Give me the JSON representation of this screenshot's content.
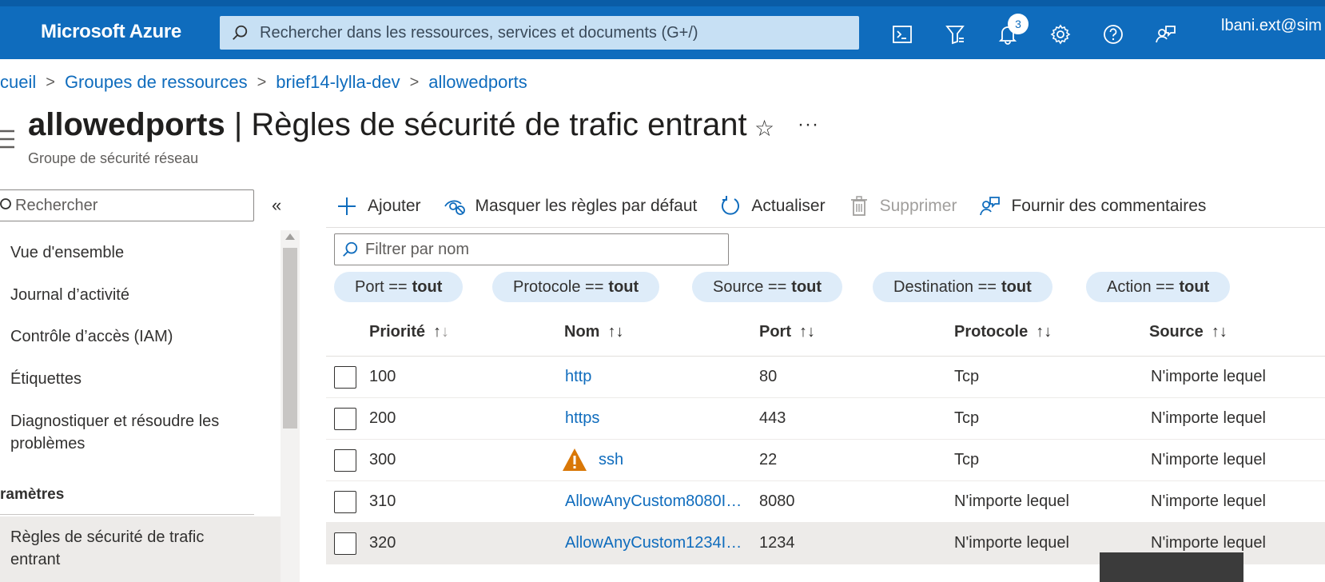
{
  "header": {
    "brand": "Microsoft Azure",
    "search_placeholder": "Rechercher dans les ressources, services et documents (G+/)",
    "notification_count": "3",
    "user": "lbani.ext@sim"
  },
  "breadcrumb": [
    "cueil",
    "Groupes de ressources",
    "brief14-lylla-dev",
    "allowedports"
  ],
  "title": {
    "resource": "allowedports",
    "separator": " | ",
    "page": "Règles de sécurité de trafic entrant",
    "subtitle": "Groupe de sécurité réseau"
  },
  "nav": {
    "search_placeholder": "Rechercher",
    "items": [
      "Vue d'ensemble",
      "Journal d’activité",
      "Contrôle d’accès (IAM)",
      "Étiquettes",
      "Diagnostiquer et résoudre les problèmes"
    ],
    "section": "ramètres",
    "active_item": "Règles de sécurité de trafic entrant"
  },
  "toolbar": {
    "add": "Ajouter",
    "hide_defaults": "Masquer les règles par défaut",
    "refresh": "Actualiser",
    "delete": "Supprimer",
    "feedback": "Fournir des commentaires"
  },
  "filter": {
    "placeholder": "Filtrer par nom",
    "pills": [
      {
        "label": "Port ==",
        "value": "tout"
      },
      {
        "label": "Protocole ==",
        "value": "tout"
      },
      {
        "label": "Source ==",
        "value": "tout"
      },
      {
        "label": "Destination ==",
        "value": "tout"
      },
      {
        "label": "Action ==",
        "value": "tout"
      }
    ]
  },
  "table": {
    "columns": [
      "Priorité",
      "Nom",
      "Port",
      "Protocole",
      "Source"
    ],
    "rows": [
      {
        "priority": "100",
        "name": "http",
        "port": "80",
        "protocol": "Tcp",
        "source": "N'importe lequel"
      },
      {
        "priority": "200",
        "name": "https",
        "port": "443",
        "protocol": "Tcp",
        "source": "N'importe lequel"
      },
      {
        "priority": "300",
        "name": "ssh",
        "port": "22",
        "protocol": "Tcp",
        "source": "N'importe lequel"
      },
      {
        "priority": "310",
        "name": "AllowAnyCustom8080I…",
        "port": "8080",
        "protocol": "N'importe lequel",
        "source": "N'importe lequel"
      },
      {
        "priority": "320",
        "name": "AllowAnyCustom1234I…",
        "port": "1234",
        "protocol": "N'importe lequel",
        "source": "N'importe lequel"
      }
    ]
  },
  "colors": {
    "azure_blue": "#0f6cbd",
    "pill_bg": "#deecf9",
    "warning": "#d97706"
  },
  "icons": [
    "cloud-shell-icon",
    "directory-filter-icon",
    "bell-icon",
    "gear-icon",
    "help-icon",
    "feedback-icon",
    "warning-icon",
    "star-icon"
  ]
}
